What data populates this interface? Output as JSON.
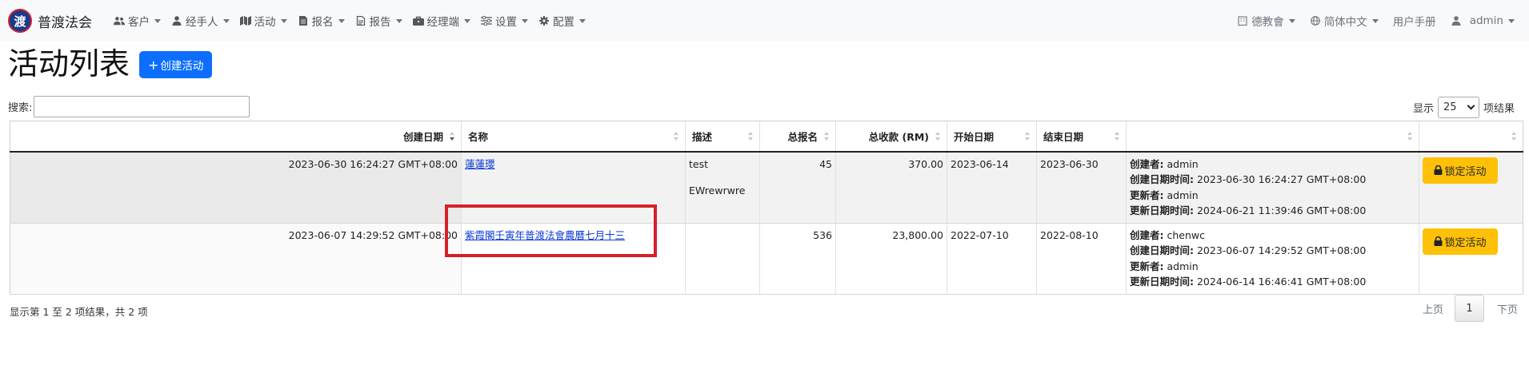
{
  "navbar": {
    "brand_logo_text": "渡",
    "brand_name": "普渡法会",
    "menu": [
      {
        "label": "客户",
        "icon": "users-icon"
      },
      {
        "label": "经手人",
        "icon": "user-icon"
      },
      {
        "label": "活动",
        "icon": "map-icon"
      },
      {
        "label": "报名",
        "icon": "file-icon"
      },
      {
        "label": "报告",
        "icon": "file-text-icon"
      },
      {
        "label": "经理端",
        "icon": "briefcase-icon"
      },
      {
        "label": "设置",
        "icon": "sliders-icon"
      },
      {
        "label": "配置",
        "icon": "gear-icon"
      }
    ],
    "right": {
      "org": "德教會",
      "language": "简体中文",
      "manual": "用户手册",
      "user": "admin"
    }
  },
  "page": {
    "title": "活动列表",
    "create_button": "创建活动",
    "search_label": "搜索:",
    "search_value": "",
    "length_prefix": "显示",
    "length_value": "25",
    "length_suffix": "项结果"
  },
  "table": {
    "columns": [
      "创建日期",
      "名称",
      "描述",
      "总报名",
      "总收款 (RM)",
      "开始日期",
      "结束日期",
      "",
      ""
    ],
    "rows": [
      {
        "created": "2023-06-30 16:24:27 GMT+08:00",
        "name": "蓮蓮瓔",
        "desc_line1": "test",
        "desc_line2": "EWrewrwre",
        "total_registrations": "45",
        "total_amount": "370.00",
        "start_date": "2023-06-14",
        "end_date": "2023-06-30",
        "meta": {
          "creator_label": "创建者:",
          "creator": "admin",
          "created_label": "创建日期时间:",
          "created": "2023-06-30 16:24:27 GMT+08:00",
          "updater_label": "更新者:",
          "updater": "admin",
          "updated_label": "更新日期时间:",
          "updated": "2024-06-21 11:39:46 GMT+08:00"
        },
        "action": "锁定活动"
      },
      {
        "created": "2023-06-07 14:29:52 GMT+08:00",
        "name": "紫霞閣壬寅年普渡法會農曆七月十三",
        "desc_line1": "",
        "desc_line2": "",
        "total_registrations": "536",
        "total_amount": "23,800.00",
        "start_date": "2022-07-10",
        "end_date": "2022-08-10",
        "meta": {
          "creator_label": "创建者:",
          "creator": "chenwc",
          "created_label": "创建日期时间:",
          "created": "2023-06-07 14:29:52 GMT+08:00",
          "updater_label": "更新者:",
          "updater": "admin",
          "updated_label": "更新日期时间:",
          "updated": "2024-06-14 16:46:41 GMT+08:00"
        },
        "action": "锁定活动"
      }
    ]
  },
  "footer": {
    "info": "显示第 1 至 2 项结果，共 2 项",
    "prev": "上页",
    "current_page": "1",
    "next": "下页"
  },
  "colors": {
    "primary": "#0d6efd",
    "warning": "#ffc107",
    "highlight": "#d6202a"
  }
}
